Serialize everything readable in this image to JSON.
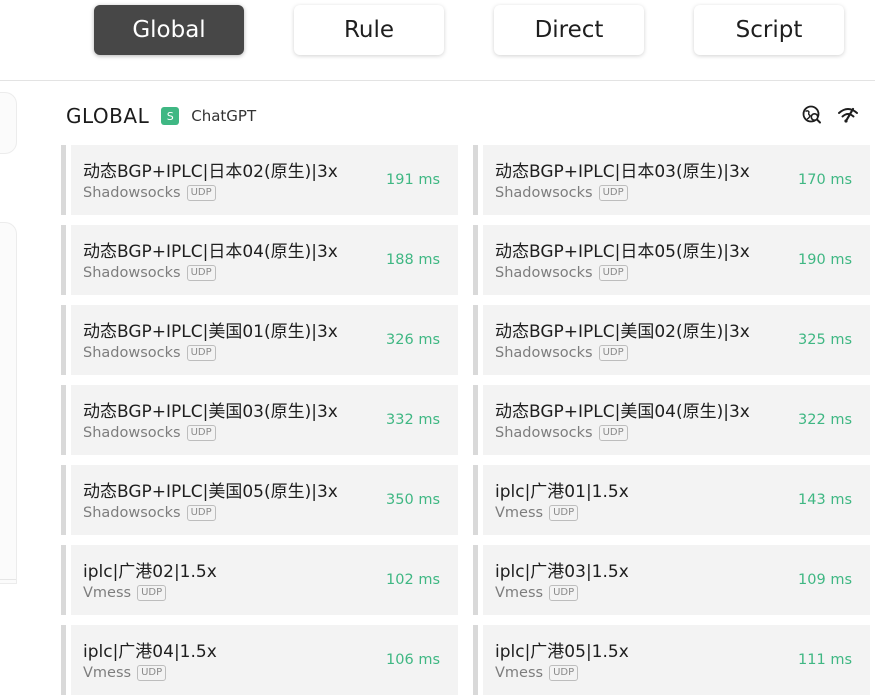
{
  "mode_tabs": [
    {
      "label": "Global",
      "active": true
    },
    {
      "label": "Rule",
      "active": false
    },
    {
      "label": "Direct",
      "active": false
    },
    {
      "label": "Script",
      "active": false
    }
  ],
  "group": {
    "name": "GLOBAL",
    "badge": "S",
    "selected": "ChatGPT",
    "icons": [
      "location-search-icon",
      "wifi-speed-icon"
    ]
  },
  "proxies": [
    {
      "name": "动态BGP+IPLC|日本02(原生)|3x",
      "type": "Shadowsocks",
      "udp": "UDP",
      "delay": "191 ms"
    },
    {
      "name": "动态BGP+IPLC|日本03(原生)|3x",
      "type": "Shadowsocks",
      "udp": "UDP",
      "delay": "170 ms"
    },
    {
      "name": "动态BGP+IPLC|日本04(原生)|3x",
      "type": "Shadowsocks",
      "udp": "UDP",
      "delay": "188 ms"
    },
    {
      "name": "动态BGP+IPLC|日本05(原生)|3x",
      "type": "Shadowsocks",
      "udp": "UDP",
      "delay": "190 ms"
    },
    {
      "name": "动态BGP+IPLC|美国01(原生)|3x",
      "type": "Shadowsocks",
      "udp": "UDP",
      "delay": "326 ms"
    },
    {
      "name": "动态BGP+IPLC|美国02(原生)|3x",
      "type": "Shadowsocks",
      "udp": "UDP",
      "delay": "325 ms"
    },
    {
      "name": "动态BGP+IPLC|美国03(原生)|3x",
      "type": "Shadowsocks",
      "udp": "UDP",
      "delay": "332 ms"
    },
    {
      "name": "动态BGP+IPLC|美国04(原生)|3x",
      "type": "Shadowsocks",
      "udp": "UDP",
      "delay": "322 ms"
    },
    {
      "name": "动态BGP+IPLC|美国05(原生)|3x",
      "type": "Shadowsocks",
      "udp": "UDP",
      "delay": "350 ms"
    },
    {
      "name": "iplc|广港01|1.5x",
      "type": "Vmess",
      "udp": "UDP",
      "delay": "143 ms"
    },
    {
      "name": "iplc|广港02|1.5x",
      "type": "Vmess",
      "udp": "UDP",
      "delay": "102 ms"
    },
    {
      "name": "iplc|广港03|1.5x",
      "type": "Vmess",
      "udp": "UDP",
      "delay": "109 ms"
    },
    {
      "name": "iplc|广港04|1.5x",
      "type": "Vmess",
      "udp": "UDP",
      "delay": "106 ms"
    },
    {
      "name": "iplc|广港05|1.5x",
      "type": "Vmess",
      "udp": "UDP",
      "delay": "111 ms"
    }
  ],
  "colors": {
    "active_tab": "#474747",
    "delay_good": "#3fb783",
    "badge": "#3fb783",
    "card_bg": "#f3f3f3"
  }
}
